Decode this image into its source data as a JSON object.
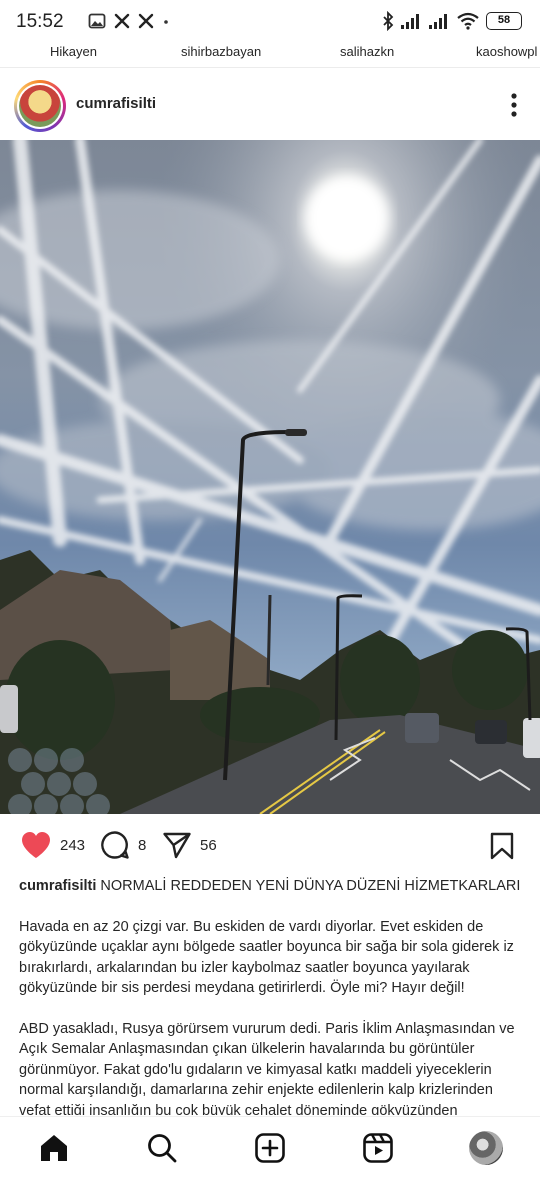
{
  "status_bar": {
    "time": "15:52",
    "left_icons": [
      "photo-notification-icon",
      "x-app-icon",
      "x-app-icon",
      "more-dot-icon"
    ],
    "right_icons": [
      "bluetooth-icon",
      "signal-icon",
      "signal-icon",
      "wifi-icon"
    ],
    "battery": "58"
  },
  "stories": [
    {
      "label": "Hikayen"
    },
    {
      "label": "sihirbazbayan"
    },
    {
      "label": "salihazkn"
    },
    {
      "label": "kaoshowpl"
    }
  ],
  "post": {
    "username": "cumrafisilti",
    "likes": "243",
    "comments": "8",
    "shares": "56",
    "caption_user": "cumrafisilti",
    "caption_title": "NORMALİ REDDEDEN YENİ DÜNYA DÜZENİ HİZMETKARLARI",
    "paragraphs": [
      "Havada en az 20 çizgi var. Bu eskiden de vardı diyorlar. Evet eskiden de gökyüzünde uçaklar aynı bölgede saatler boyunca bir sağa bir sola giderek iz bırakırlardı, arkalarından bu izler kaybolmaz saatler boyunca yayılarak gökyüzünde bir sis perdesi meydana getirirlerdi. Öyle mi? Hayır değil!",
      "ABD yasakladı, Rusya görürsem vururum dedi. Paris İklim Anlaşmasından ve Açık Semalar Anlaşmasından çıkan ülkelerin havalarında bu görüntüler görünmüyor.  Fakat gdo'lu gıdaların ve kimyasal katkı maddeli yiyeceklerin normal karşılandığı, damarlarına zehir enjekte edilenlerin kalp krizlerinden vefat ettiği insanlığın bu çok büyük cehalet döneminde gökyüzünden"
    ]
  },
  "nav": {
    "items": [
      "home-icon",
      "search-icon",
      "create-post-icon",
      "reels-icon",
      "profile-avatar"
    ]
  },
  "colors": {
    "like_red": "#ed4956",
    "text": "#262626"
  }
}
